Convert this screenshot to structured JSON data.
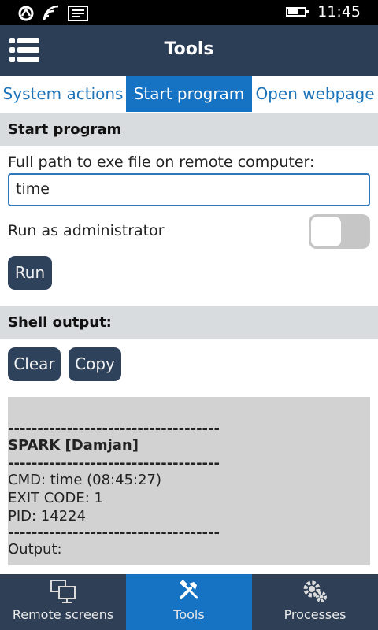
{
  "status_bar": {
    "time": "11:45",
    "battery_level": 0.6
  },
  "header": {
    "title": "Tools"
  },
  "tabs": [
    {
      "label": "System actions",
      "active": false
    },
    {
      "label": "Start program",
      "active": true
    },
    {
      "label": "Open webpage",
      "active": false
    }
  ],
  "start_program": {
    "section_title": "Start program",
    "path_label": "Full path to exe file on remote computer:",
    "path_value": "time",
    "admin_label": "Run as administrator",
    "admin_enabled": false,
    "run_label": "Run"
  },
  "shell": {
    "section_title": "Shell output:",
    "clear_label": "Clear",
    "copy_label": "Copy",
    "output_lines": [
      "------------------------------------",
      "SPARK [Damjan]",
      "------------------------------------",
      "CMD: time (08:45:27)",
      "EXIT CODE: 1",
      "PID: 14224",
      "------------------------------------",
      "Output:"
    ]
  },
  "bottom_nav": [
    {
      "label": "Remote screens",
      "icon": "monitors-icon",
      "active": false
    },
    {
      "label": "Tools",
      "icon": "tools-icon",
      "active": true
    },
    {
      "label": "Processes",
      "icon": "gears-icon",
      "active": false
    }
  ],
  "colors": {
    "header_bg": "#2b3e56",
    "accent": "#1672c2",
    "section_bg": "#d8dcdf",
    "button_bg": "#2f425c",
    "output_bg": "#d2d2d2",
    "nav_bg": "#2f3f55"
  }
}
